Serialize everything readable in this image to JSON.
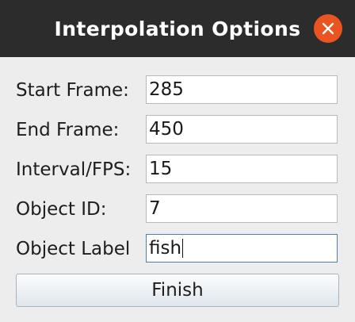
{
  "window": {
    "title": "Interpolation Options",
    "close_icon": "close-icon",
    "accent_color": "#e95420"
  },
  "form": {
    "fields": [
      {
        "label": "Start Frame:",
        "value": "285"
      },
      {
        "label": "End Frame:",
        "value": "450"
      },
      {
        "label": "Interval/FPS:",
        "value": "15"
      },
      {
        "label": "Object ID:",
        "value": "7"
      },
      {
        "label": "Object Label",
        "value": "fish"
      }
    ],
    "focused_field": "Object Label",
    "finish_label": "Finish"
  }
}
